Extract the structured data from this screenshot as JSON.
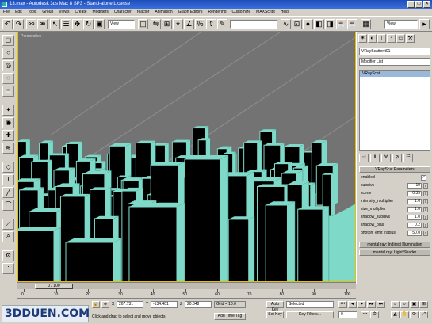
{
  "window": {
    "title": "13.max - Autodesk 3ds Max 8 SP3 - Stand-alone License",
    "minimize": "_",
    "maximize": "□",
    "close": "✕"
  },
  "menu": [
    "File",
    "Edit",
    "Tools",
    "Group",
    "Views",
    "Create",
    "Modifiers",
    "Character",
    "reactor",
    "Animation",
    "Graph Editors",
    "Rendering",
    "Customize",
    "MAXScript",
    "Help"
  ],
  "toolbar": {
    "view_dropdown": "View",
    "selection_set_dropdown": "",
    "right_dropdown": "View"
  },
  "viewport": {
    "label": "Perspective"
  },
  "command_panel": {
    "object_name": "VRayScatterIt01",
    "modifier_list": "Modifier List",
    "stack_selected": "VRayScat",
    "rollout_title": "VRayScat Parameters",
    "params": [
      {
        "label": "enabled",
        "value": "",
        "kind": "check",
        "checked": "✓"
      },
      {
        "label": "subdivs",
        "value": "10"
      },
      {
        "label": "scene",
        "value": "0.35"
      },
      {
        "label": "intensity_multiplier",
        "value": "1.0"
      },
      {
        "label": "size_multiplier",
        "value": "1.0"
      },
      {
        "label": "shadow_subdivs",
        "value": "1.0"
      },
      {
        "label": "shadow_bias",
        "value": "0.2"
      },
      {
        "label": "photon_emit_radius",
        "value": "50.0"
      }
    ],
    "rollout2": "mental ray: Indirect Illumination",
    "rollout3": "mental ray: Light Shader"
  },
  "timeline": {
    "thumb": "0 / 100",
    "ticks": [
      "0",
      "10",
      "20",
      "30",
      "40",
      "50",
      "60",
      "70",
      "80",
      "90",
      "100"
    ]
  },
  "status": {
    "x_label": "X",
    "x_value": "267.731",
    "y_label": "Y",
    "y_value": "-134.401",
    "z_label": "Z",
    "z_value": "20.348",
    "grid": "Grid = 10.0",
    "autokey": "Auto Key",
    "selected_dropdown": "Selected",
    "setkey": "Set Key",
    "key_filters": "Key Filters...",
    "frame": "0",
    "prompt": "Click and drag to select and move objects",
    "add_time_tag": "Add Time Tag"
  },
  "watermark": "3DDUEN.COM",
  "colors": {
    "building_edge": "#7fd9c8",
    "building_face": "#000000",
    "viewport_bg": "#737373",
    "title_blue": "#1f4fb7",
    "viewport_border": "#e8c000"
  }
}
